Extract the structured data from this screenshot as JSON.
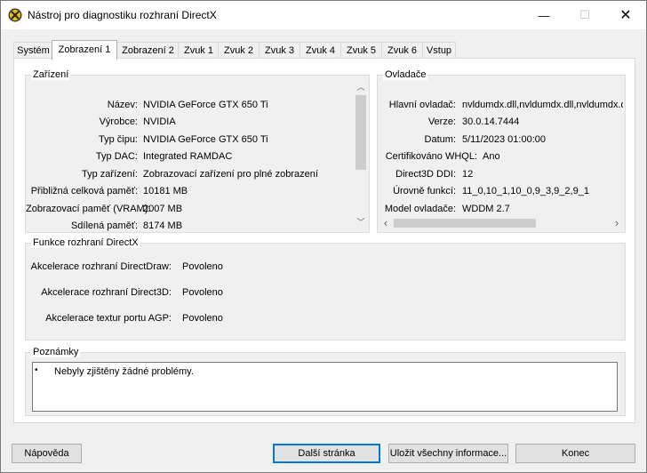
{
  "window": {
    "title": "Nástroj pro diagnostiku rozhraní DirectX",
    "min_label": "—",
    "max_label": "☐",
    "close_label": "✕"
  },
  "tabs": [
    {
      "label": "Systém"
    },
    {
      "label": "Zobrazení 1",
      "active": true
    },
    {
      "label": "Zobrazení 2"
    },
    {
      "label": "Zvuk 1"
    },
    {
      "label": "Zvuk 2"
    },
    {
      "label": "Zvuk 3"
    },
    {
      "label": "Zvuk 4"
    },
    {
      "label": "Zvuk 5"
    },
    {
      "label": "Zvuk 6"
    },
    {
      "label": "Vstup"
    }
  ],
  "device": {
    "title": "Zařízení",
    "rows": [
      {
        "label": "Název:",
        "value": "NVIDIA GeForce GTX 650 Ti"
      },
      {
        "label": "Výrobce:",
        "value": "NVIDIA"
      },
      {
        "label": "Typ čipu:",
        "value": "NVIDIA GeForce GTX 650 Ti"
      },
      {
        "label": "Typ DAC:",
        "value": "Integrated RAMDAC"
      },
      {
        "label": "Typ zařízení:",
        "value": "Zobrazovací zařízení pro plné zobrazení"
      },
      {
        "label": "Přibližná celková paměť:",
        "value": "10181 MB"
      },
      {
        "label": "Zobrazovací paměť (VRAM):",
        "value": "2007 MB"
      },
      {
        "label": "Sdílená paměť:",
        "value": "8174 MB"
      }
    ],
    "scroll_up": "︿",
    "scroll_down": "﹀"
  },
  "driver": {
    "title": "Ovladače",
    "rows": [
      {
        "label": "Hlavní ovladač:",
        "value": "nvldumdx.dll,nvldumdx.dll,nvldumdx.dl"
      },
      {
        "label": "Verze:",
        "value": "30.0.14.7444"
      },
      {
        "label": "Datum:",
        "value": "5/11/2023 01:00:00"
      },
      {
        "label": "Certifikováno WHQL:",
        "value": "Ano"
      },
      {
        "label": "Direct3D DDI:",
        "value": "12"
      },
      {
        "label": "Úrovně funkcí:",
        "value": "11_0,10_1,10_0,9_3,9_2,9_1"
      },
      {
        "label": "Model ovladače:",
        "value": "WDDM 2.7"
      }
    ],
    "scroll_left": "‹",
    "scroll_right": "›"
  },
  "features": {
    "title": "Funkce rozhraní DirectX",
    "rows": [
      {
        "label": "Akcelerace rozhraní DirectDraw:",
        "value": "Povoleno"
      },
      {
        "label": "Akcelerace rozhraní Direct3D:",
        "value": "Povoleno"
      },
      {
        "label": "Akcelerace textur portu AGP:",
        "value": "Povoleno"
      }
    ]
  },
  "notes": {
    "title": "Poznámky",
    "bullet": "•",
    "items": [
      "Nebyly zjištěny žádné problémy."
    ]
  },
  "buttons": {
    "help": "Nápověda",
    "next": "Další stránka",
    "save_all": "Uložit všechny informace...",
    "exit": "Konec"
  }
}
